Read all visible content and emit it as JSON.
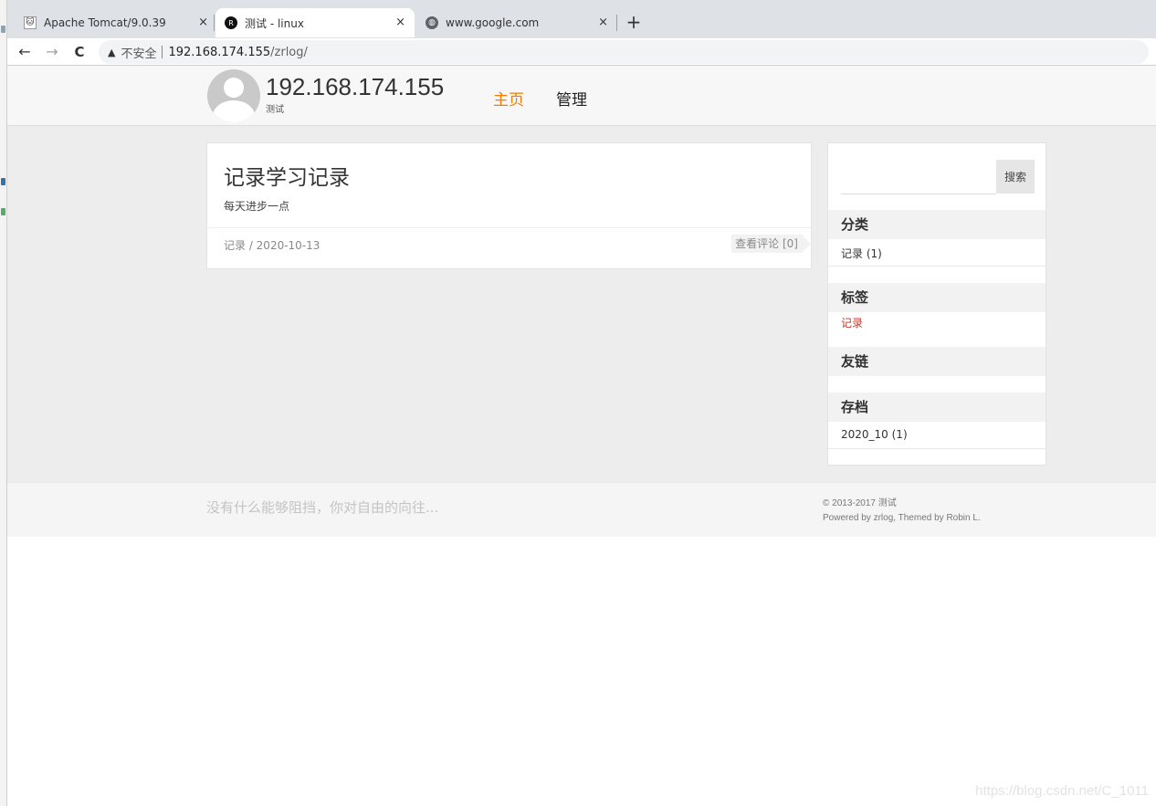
{
  "browser": {
    "tabs": [
      {
        "title": "Apache Tomcat/9.0.39",
        "icon": "tomcat-icon",
        "active": false
      },
      {
        "title": "测试 - linux",
        "icon": "zrlog-icon",
        "active": true
      },
      {
        "title": "www.google.com",
        "icon": "globe-icon",
        "active": false
      }
    ],
    "new_tab_label": "+",
    "close_label": "×",
    "nav": {
      "back": "←",
      "forward": "→",
      "reload": "C"
    },
    "address": {
      "warning_icon": "▲",
      "security_label": "不安全",
      "host": "192.168.174.155",
      "path": "/zrlog/"
    }
  },
  "site": {
    "title": "192.168.174.155",
    "subtitle": "测试",
    "nav": [
      {
        "label": "主页",
        "active": true,
        "color": "#f57c00"
      },
      {
        "label": "管理",
        "active": false
      }
    ]
  },
  "post": {
    "title": "记录学习记录",
    "summary": "每天进步一点",
    "meta": "记录 / 2020-10-13",
    "comments_label": "查看评论 [0]"
  },
  "sidebar": {
    "search_button": "搜索",
    "search_placeholder": "",
    "sections": {
      "categories": {
        "heading": "分类",
        "items": [
          "记录 (1)"
        ]
      },
      "tags": {
        "heading": "标签",
        "items": [
          "记录"
        ]
      },
      "links": {
        "heading": "友链",
        "items": []
      },
      "archives": {
        "heading": "存档",
        "items": [
          "2020_10 (1)"
        ]
      }
    }
  },
  "footer": {
    "quote": "没有什么能够阻挡，你对自由的向往...",
    "copyright": "© 2013-2017 测试",
    "powered_by": "Powered by zrlog, Themed by Robin L."
  },
  "watermark": "https://blog.csdn.net/C_1011"
}
